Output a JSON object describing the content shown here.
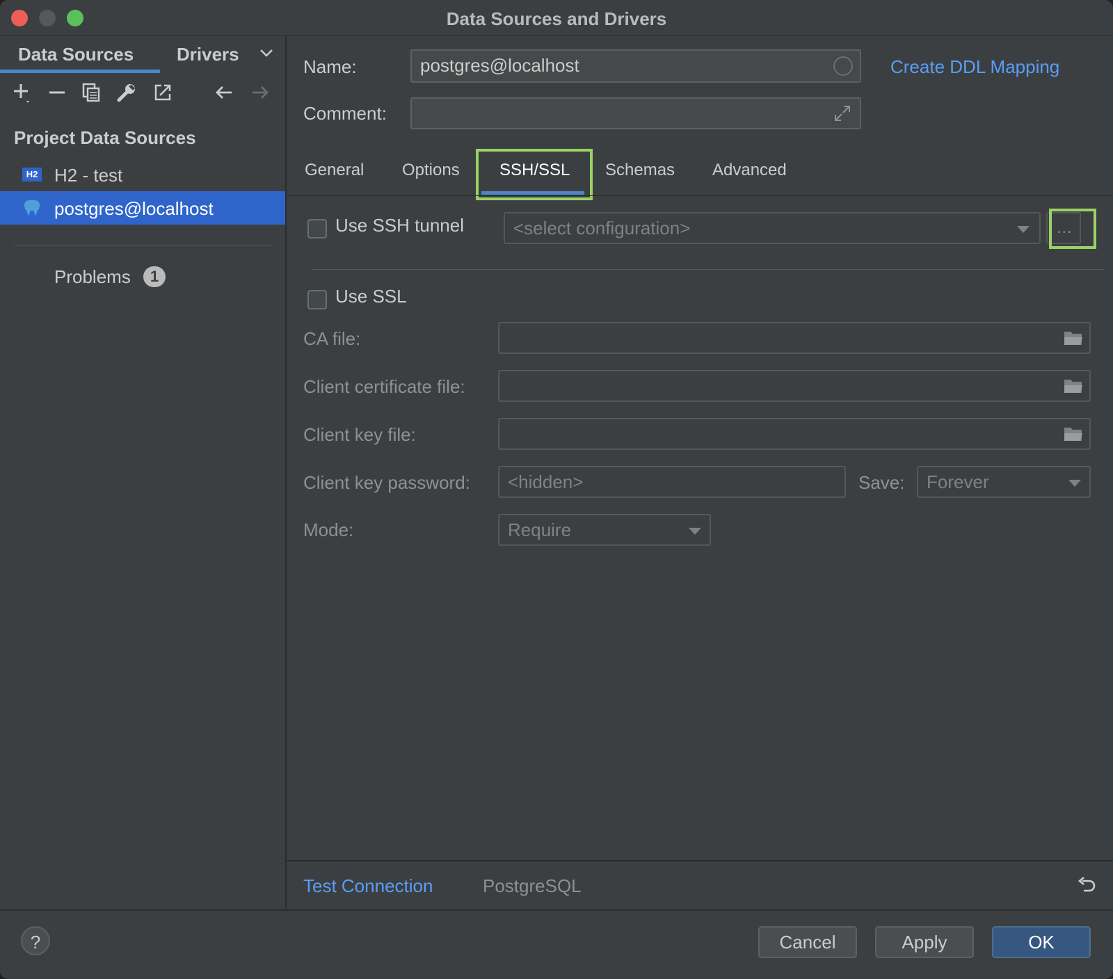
{
  "window": {
    "title": "Data Sources and Drivers"
  },
  "sidebar": {
    "tabs": [
      {
        "label": "Data Sources"
      },
      {
        "label": "Drivers"
      }
    ],
    "section_title": "Project Data Sources",
    "items": [
      {
        "label": "H2 - test",
        "icon": "H2"
      },
      {
        "label": "postgres@localhost",
        "icon": "postgresql-elephant-icon"
      }
    ],
    "problems": {
      "label": "Problems",
      "count": "1"
    },
    "toolbar": [
      "add-icon",
      "remove-icon",
      "duplicate-icon",
      "wrench-icon",
      "export-icon",
      "back-arrow-icon",
      "forward-arrow-icon"
    ]
  },
  "form": {
    "name_label": "Name:",
    "name_value": "postgres@localhost",
    "create_ddl_link": "Create DDL Mapping",
    "comment_label": "Comment:",
    "comment_value": ""
  },
  "tabs": [
    {
      "label": "General"
    },
    {
      "label": "Options"
    },
    {
      "label": "SSH/SSL"
    },
    {
      "label": "Schemas"
    },
    {
      "label": "Advanced"
    }
  ],
  "active_tab": "SSH/SSL",
  "ssh": {
    "checkbox_label": "Use SSH tunnel",
    "checked": false,
    "config_placeholder": "<select configuration>",
    "more_button": "..."
  },
  "ssl": {
    "checkbox_label": "Use SSL",
    "checked": false,
    "ca_label": "CA file:",
    "cert_label": "Client certificate file:",
    "key_label": "Client key file:",
    "password_label": "Client key password:",
    "password_value": "<hidden>",
    "save_label": "Save:",
    "save_value": "Forever",
    "mode_label": "Mode:",
    "mode_value": "Require"
  },
  "bottom": {
    "test_connection": "Test Connection",
    "driver_name": "PostgreSQL"
  },
  "footer": {
    "help": "?",
    "cancel": "Cancel",
    "apply": "Apply",
    "ok": "OK"
  },
  "colors": {
    "accent": "#4a88c7",
    "link": "#589df6",
    "selection": "#2f65ca",
    "highlight": "#9bd266"
  }
}
